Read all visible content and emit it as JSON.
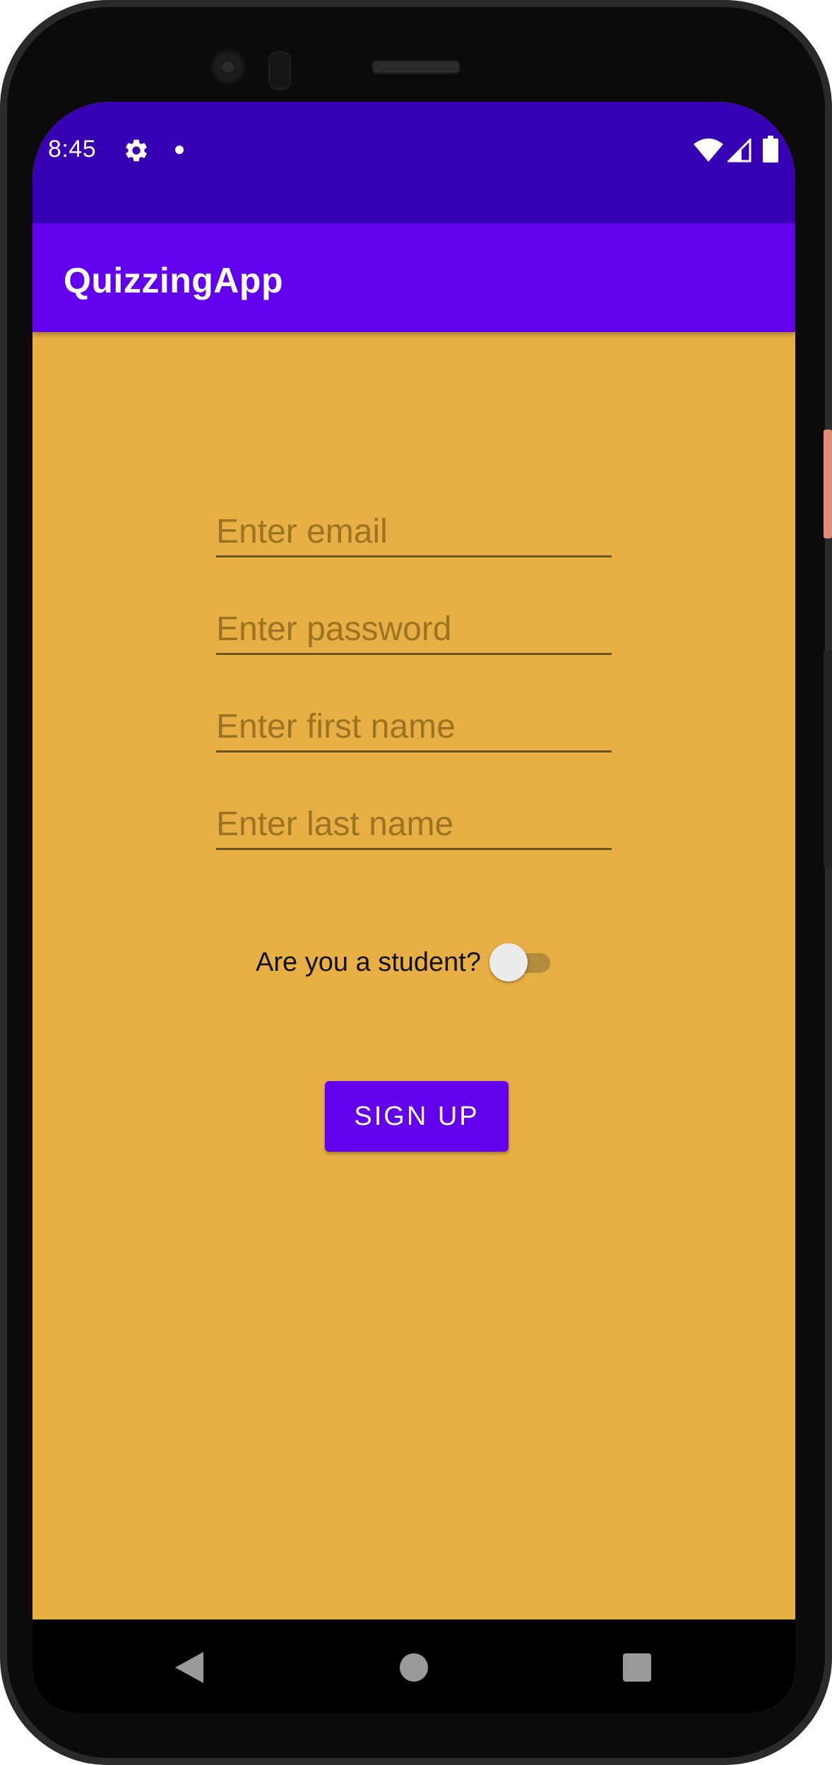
{
  "status_bar": {
    "time": "8:45",
    "icons": [
      "settings-gear-icon",
      "notification-dot-icon",
      "wifi-icon",
      "signal-icon",
      "battery-icon"
    ]
  },
  "app_bar": {
    "title": "QuizzingApp"
  },
  "form": {
    "email_placeholder": "Enter email",
    "password_placeholder": "Enter password",
    "first_name_placeholder": "Enter first name",
    "last_name_placeholder": "Enter last name",
    "student_label": "Are you a student?",
    "student_toggle_on": false,
    "signup_label": "SIGN UP"
  },
  "nav_bar": {
    "icons": [
      "back-icon",
      "home-icon",
      "recents-icon"
    ]
  },
  "colors": {
    "status_bar": "#3700b3",
    "app_bar": "#6200ee",
    "background": "#e8b044",
    "button": "#6200ee"
  }
}
